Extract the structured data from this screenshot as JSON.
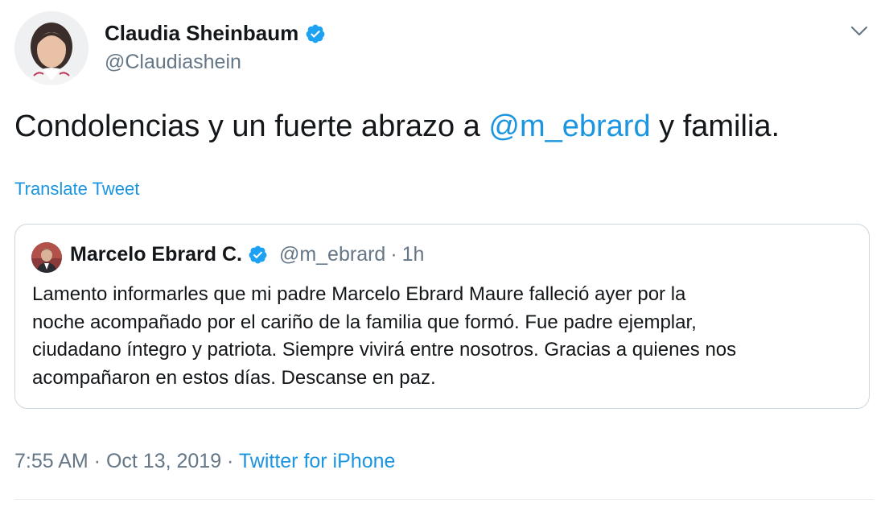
{
  "author": {
    "display_name": "Claudia Sheinbaum",
    "handle": "@Claudiashein",
    "verified": true,
    "avatar_icon": "profile-photo"
  },
  "tweet": {
    "text_prefix": "Condolencias y un fuerte abrazo a ",
    "mention": "@m_ebrard",
    "text_suffix": " y familia.",
    "translate_label": "Translate Tweet"
  },
  "quoted": {
    "display_name": "Marcelo Ebrard C.",
    "handle": "@m_ebrard",
    "separator": "·",
    "time": "1h",
    "verified": true,
    "text": "Lamento informarles que mi padre Marcelo Ebrard Maure falleció ayer por la\nnoche acompañado por el cariño de la familia que formó. Fue padre ejemplar,\nciudadano íntegro y patriota. Siempre vivirá entre  nosotros. Gracias a quienes nos\nacompañaron en estos días. Descanse en paz."
  },
  "meta": {
    "time": "7:55 AM",
    "sep1": " · ",
    "date": "Oct 13, 2019",
    "sep2": " · ",
    "source": "Twitter for iPhone"
  },
  "colors": {
    "link": "#1b95e0",
    "verified": "#1da1f2",
    "secondary_text": "#657786",
    "border": "#ccd6dd"
  },
  "icons": {
    "verified": "verified-badge-icon",
    "menu": "chevron-down-icon"
  }
}
